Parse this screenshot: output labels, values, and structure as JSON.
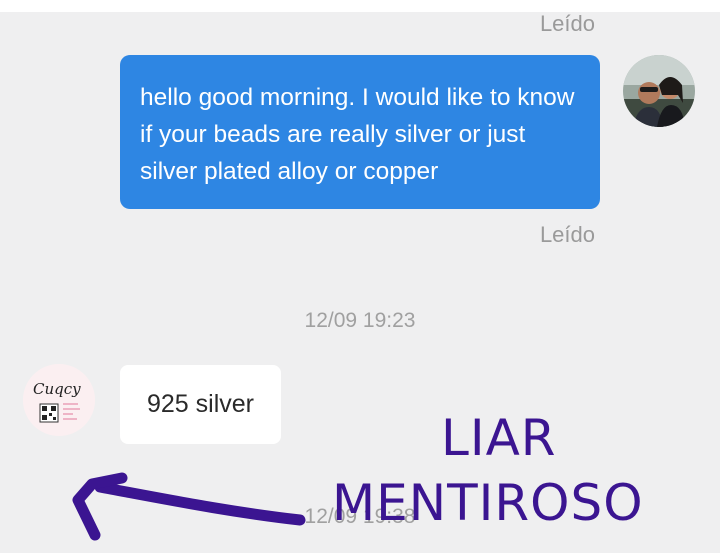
{
  "messages": {
    "read_top": "Leído",
    "outgoing_text": "hello good morning. I would like to know if your beads are really silver or just silver plated alloy or copper",
    "read_bottom": "Leído",
    "timestamp_1": "12/09 19:23",
    "incoming_text": "925 silver",
    "timestamp_2": "12/09 19:38"
  },
  "shop_avatar": {
    "logo_text": "Cuqcy"
  },
  "annotation": {
    "line1": "LIAR",
    "line2": "MENTIROSO",
    "color": "#3b1591"
  },
  "colors": {
    "outgoing_bubble": "#2e86e3",
    "background": "#efeff0"
  }
}
